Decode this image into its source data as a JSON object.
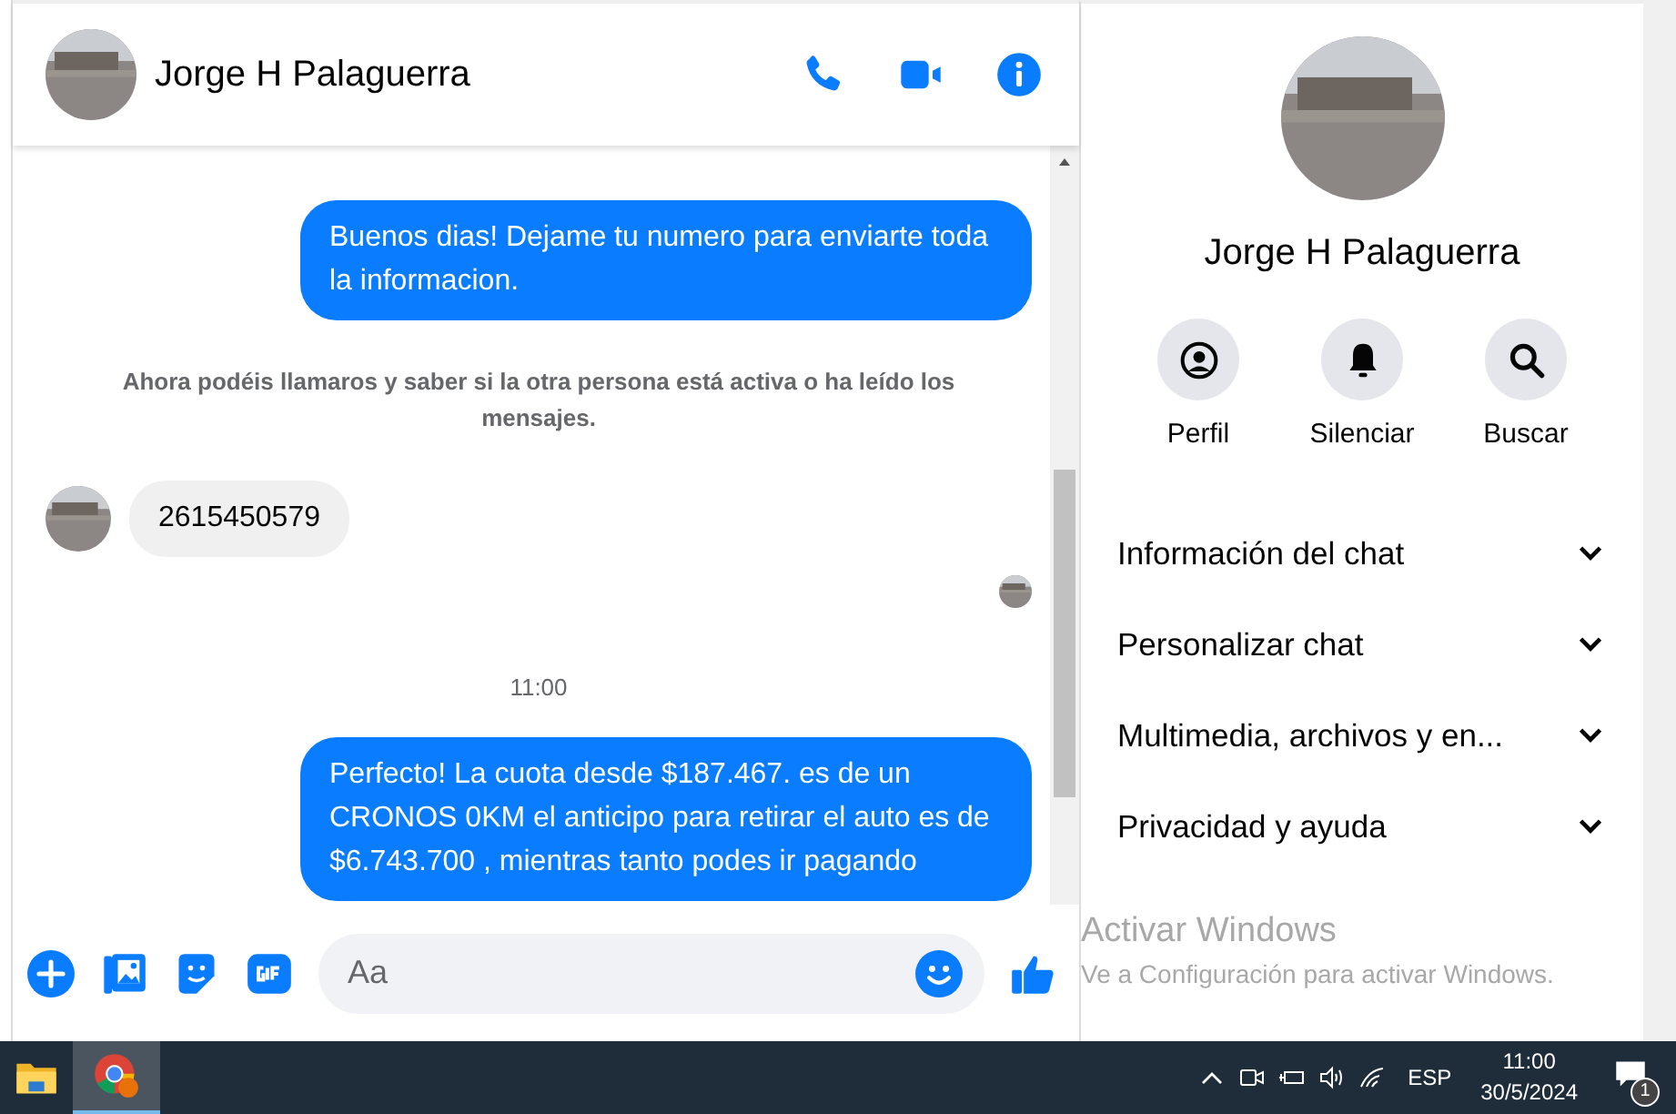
{
  "chat": {
    "contact_name": "Jorge H Palaguerra",
    "messages": [
      {
        "kind": "outgoing",
        "text": "Buenos dias! Dejame tu numero para enviarte toda la informacion."
      },
      {
        "kind": "notice",
        "text": "Ahora podéis llamaros y saber si la otra persona está activa o ha leído los mensajes."
      },
      {
        "kind": "incoming",
        "text": "2615450579"
      },
      {
        "kind": "seen"
      },
      {
        "kind": "time",
        "text": "11:00"
      },
      {
        "kind": "outgoing",
        "text": "Perfecto! La cuota desde $187.467. es de un CRONOS 0KM el anticipo para retirar el auto es de $6.743.700 , mientras tanto podes ir pagando"
      }
    ],
    "composer": {
      "placeholder": "Aa"
    }
  },
  "details": {
    "name": "Jorge H Palaguerra",
    "actions": [
      {
        "kind": "profile",
        "label": "Perfil"
      },
      {
        "kind": "mute",
        "label": "Silenciar"
      },
      {
        "kind": "search",
        "label": "Buscar"
      }
    ],
    "sections": [
      {
        "label": "Información del chat",
        "expanded": false
      },
      {
        "label": "Personalizar chat",
        "expanded": false
      },
      {
        "label": "Multimedia, archivos y en...",
        "expanded": false
      },
      {
        "label": "Privacidad y ayuda",
        "expanded": false
      }
    ]
  },
  "activation_notice": {
    "title": "Activar Windows",
    "subtitle": "Ve a Configuración para activar Windows."
  },
  "taskbar": {
    "language": "ESP",
    "time": "11:00",
    "date": "30/5/2024",
    "notification_count": "1"
  }
}
